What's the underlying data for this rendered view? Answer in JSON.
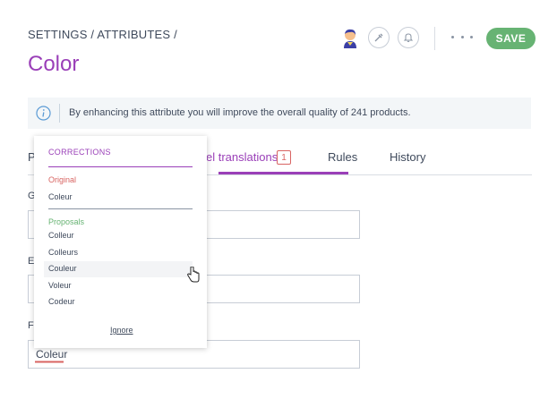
{
  "header": {
    "breadcrumb": "SETTINGS / ATTRIBUTES /",
    "title": "Color",
    "save_label": "SAVE",
    "accent_color": "#9a3fb8",
    "save_color": "#67b373"
  },
  "helper": {
    "text": "By enhancing this attribute you will improve the overall quality of 241 products."
  },
  "tabs": [
    {
      "label": "P"
    },
    {
      "label": "el translations",
      "badge": "1"
    },
    {
      "label": "Rules"
    },
    {
      "label": "History"
    }
  ],
  "fields": {
    "label_1": "G",
    "label_2": "E",
    "label_3": "F",
    "value_3": "Coleur"
  },
  "popup": {
    "heading": "CORRECTIONS",
    "original_label": "Original",
    "original_value": "Coleur",
    "proposals_label": "Proposals",
    "proposals": [
      "Colleur",
      "Colleurs",
      "Couleur",
      "Voleur",
      "Codeur"
    ],
    "ignore_label": "Ignore",
    "original_color": "#d86462",
    "proposals_color": "#67b373"
  }
}
